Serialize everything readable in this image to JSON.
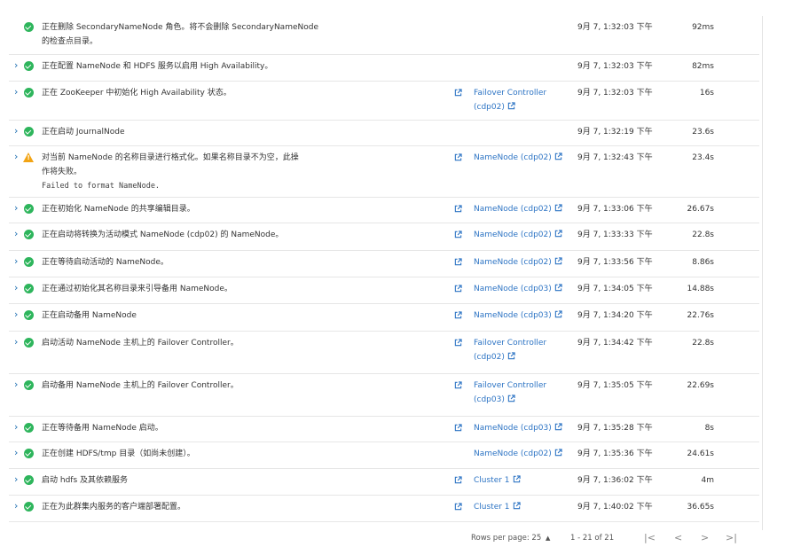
{
  "colors": {
    "link": "#2d74c4",
    "success": "#2eb55c",
    "warning": "#f2a414"
  },
  "rows": [
    {
      "status": "success",
      "expandable": false,
      "description": [
        "正在删除 SecondaryNameNode 角色。将不会删除 SecondaryNameNode",
        "的检查点目录。"
      ],
      "detail": "",
      "host": [],
      "has_link_icon": false,
      "time": "9月 7, 1:32:03 下午",
      "duration": "92ms"
    },
    {
      "status": "success",
      "expandable": true,
      "description": [
        "正在配置 NameNode 和 HDFS 服务以启用 High Availability。"
      ],
      "detail": "",
      "host": [],
      "has_link_icon": false,
      "time": "9月 7, 1:32:03 下午",
      "duration": "82ms"
    },
    {
      "status": "success",
      "expandable": true,
      "description": [
        "正在 ZooKeeper 中初始化 High Availability 状态。"
      ],
      "detail": "",
      "host": [
        "Failover Controller",
        "(cdp02)"
      ],
      "has_link_icon": true,
      "time": "9月 7, 1:32:03 下午",
      "duration": "16s"
    },
    {
      "status": "success",
      "expandable": true,
      "description": [
        "正在启动 JournalNode"
      ],
      "detail": "",
      "host": [],
      "has_link_icon": false,
      "time": "9月 7, 1:32:19 下午",
      "duration": "23.6s"
    },
    {
      "status": "warning",
      "expandable": true,
      "description": [
        "对当前 NameNode 的名称目录进行格式化。如果名称目录不为空，此操",
        "作将失败。"
      ],
      "detail": "Failed to format NameNode.",
      "host": [
        "NameNode (cdp02)"
      ],
      "has_link_icon": true,
      "time": "9月 7, 1:32:43 下午",
      "duration": "23.4s"
    },
    {
      "status": "success",
      "expandable": true,
      "description": [
        "正在初始化 NameNode 的共享编辑目录。"
      ],
      "detail": "",
      "host": [
        "NameNode (cdp02)"
      ],
      "has_link_icon": true,
      "time": "9月 7, 1:33:06 下午",
      "duration": "26.67s"
    },
    {
      "status": "success",
      "expandable": true,
      "description": [
        "正在启动将转换为活动模式 NameNode (cdp02) 的 NameNode。"
      ],
      "detail": "",
      "host": [
        "NameNode (cdp02)"
      ],
      "has_link_icon": true,
      "time": "9月 7, 1:33:33 下午",
      "duration": "22.8s"
    },
    {
      "status": "success",
      "expandable": true,
      "description": [
        "正在等待启动活动的 NameNode。"
      ],
      "detail": "",
      "host": [
        "NameNode (cdp02)"
      ],
      "has_link_icon": true,
      "time": "9月 7, 1:33:56 下午",
      "duration": "8.86s"
    },
    {
      "status": "success",
      "expandable": true,
      "description": [
        "正在通过初始化其名称目录来引导备用 NameNode。"
      ],
      "detail": "",
      "host": [
        "NameNode (cdp03)"
      ],
      "has_link_icon": true,
      "time": "9月 7, 1:34:05 下午",
      "duration": "14.88s"
    },
    {
      "status": "success",
      "expandable": true,
      "description": [
        "正在启动备用 NameNode"
      ],
      "detail": "",
      "host": [
        "NameNode (cdp03)"
      ],
      "has_link_icon": true,
      "time": "9月 7, 1:34:20 下午",
      "duration": "22.76s"
    },
    {
      "status": "success",
      "expandable": true,
      "description": [
        "启动活动 NameNode 主机上的 Failover Controller。"
      ],
      "detail": "",
      "host": [
        "Failover Controller",
        "(cdp02)"
      ],
      "has_link_icon": true,
      "time": "9月 7, 1:34:42 下午",
      "duration": "22.8s"
    },
    {
      "status": "success",
      "expandable": true,
      "description": [
        "启动备用 NameNode 主机上的 Failover Controller。"
      ],
      "detail": "",
      "host": [
        "Failover Controller",
        "(cdp03)"
      ],
      "has_link_icon": true,
      "time": "9月 7, 1:35:05 下午",
      "duration": "22.69s"
    },
    {
      "status": "success",
      "expandable": true,
      "description": [
        "正在等待备用 NameNode 启动。"
      ],
      "detail": "",
      "host": [
        "NameNode (cdp03)"
      ],
      "has_link_icon": true,
      "time": "9月 7, 1:35:28 下午",
      "duration": "8s"
    },
    {
      "status": "success",
      "expandable": true,
      "description": [
        "正在创建 HDFS/tmp 目录（如尚未创建）。"
      ],
      "detail": "",
      "host": [
        "NameNode (cdp02)"
      ],
      "has_link_icon": false,
      "time": "9月 7, 1:35:36 下午",
      "duration": "24.61s"
    },
    {
      "status": "success",
      "expandable": true,
      "description": [
        "启动 hdfs 及其依赖服务"
      ],
      "detail": "",
      "host": [
        "Cluster 1"
      ],
      "has_link_icon": true,
      "time": "9月 7, 1:36:02 下午",
      "duration": "4m"
    },
    {
      "status": "success",
      "expandable": true,
      "description": [
        "正在为此群集内服务的客户端部署配置。"
      ],
      "detail": "",
      "host": [
        "Cluster 1"
      ],
      "has_link_icon": true,
      "time": "9月 7, 1:40:02 下午",
      "duration": "36.65s"
    }
  ],
  "pagination": {
    "rows_per_page_label": "Rows per page: 25",
    "rows_per_page_caret": "▲",
    "range": "1 - 21 of 21",
    "first": "|<",
    "prev": "<",
    "next": ">",
    "last": ">|"
  }
}
